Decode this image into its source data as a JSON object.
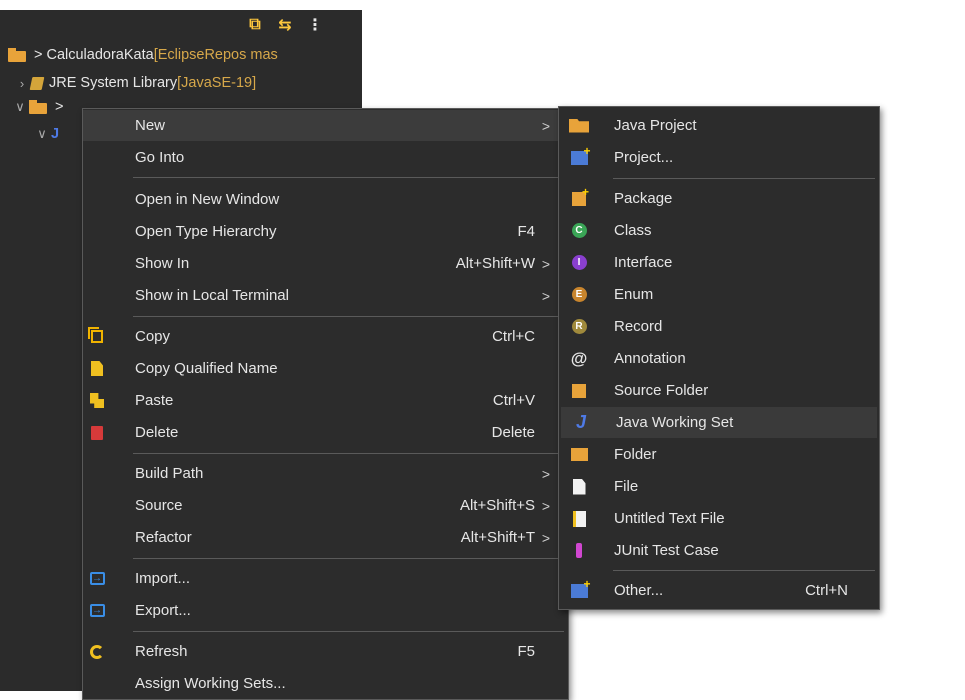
{
  "toolbar": {
    "icons": [
      "collapse-all-icon",
      "link-with-editor-icon",
      "view-menu-icon"
    ],
    "icon_color": "#ffc83d"
  },
  "tree": {
    "rows": [
      {
        "label": "CalculadoraKata",
        "decoration": " [EclipseRepos mas",
        "prefix": ">"
      },
      {
        "label": "JRE System Library",
        "decoration": " [JavaSE-19]"
      }
    ],
    "hidden_row_prefix": ">",
    "hidden_row2_glyph": "J"
  },
  "context_menu": {
    "items": [
      {
        "label": "New",
        "shortcut": "",
        "submenu": true,
        "icon": ""
      },
      {
        "label": "Go Into",
        "shortcut": "",
        "submenu": false,
        "icon": ""
      },
      {
        "label": "Open in New Window",
        "shortcut": "",
        "submenu": false,
        "icon": ""
      },
      {
        "label": "Open Type Hierarchy",
        "shortcut": "F4",
        "submenu": false,
        "icon": ""
      },
      {
        "label": "Show In",
        "shortcut": "Alt+Shift+W",
        "submenu": true,
        "icon": ""
      },
      {
        "label": "Show in Local Terminal",
        "shortcut": "",
        "submenu": true,
        "icon": ""
      },
      {
        "label": "Copy",
        "shortcut": "Ctrl+C",
        "submenu": false,
        "icon": "copy-icon"
      },
      {
        "label": "Copy Qualified Name",
        "shortcut": "",
        "submenu": false,
        "icon": "copy-qualified-name-icon"
      },
      {
        "label": "Paste",
        "shortcut": "Ctrl+V",
        "submenu": false,
        "icon": "paste-icon"
      },
      {
        "label": "Delete",
        "shortcut": "Delete",
        "submenu": false,
        "icon": "delete-icon"
      },
      {
        "label": "Build Path",
        "shortcut": "",
        "submenu": true,
        "icon": ""
      },
      {
        "label": "Source",
        "shortcut": "Alt+Shift+S",
        "submenu": true,
        "icon": ""
      },
      {
        "label": "Refactor",
        "shortcut": "Alt+Shift+T",
        "submenu": true,
        "icon": ""
      },
      {
        "label": "Import...",
        "shortcut": "",
        "submenu": false,
        "icon": "import-icon"
      },
      {
        "label": "Export...",
        "shortcut": "",
        "submenu": false,
        "icon": "export-icon"
      },
      {
        "label": "Refresh",
        "shortcut": "F5",
        "submenu": false,
        "icon": "refresh-icon"
      },
      {
        "label": "Assign Working Sets...",
        "shortcut": "",
        "submenu": false,
        "icon": ""
      }
    ],
    "arrow_glyph": ">"
  },
  "new_submenu": {
    "items": [
      {
        "label": "Java Project",
        "shortcut": "",
        "icon": "java-project-icon"
      },
      {
        "label": "Project...",
        "shortcut": "",
        "icon": "project-icon"
      },
      {
        "label": "Package",
        "shortcut": "",
        "icon": "package-icon"
      },
      {
        "label": "Class",
        "shortcut": "",
        "icon": "class-icon"
      },
      {
        "label": "Interface",
        "shortcut": "",
        "icon": "interface-icon"
      },
      {
        "label": "Enum",
        "shortcut": "",
        "icon": "enum-icon"
      },
      {
        "label": "Record",
        "shortcut": "",
        "icon": "record-icon"
      },
      {
        "label": "Annotation",
        "shortcut": "",
        "icon": "annotation-icon"
      },
      {
        "label": "Source Folder",
        "shortcut": "",
        "icon": "source-folder-icon"
      },
      {
        "label": "Java Working Set",
        "shortcut": "",
        "icon": "java-working-set-icon"
      },
      {
        "label": "Folder",
        "shortcut": "",
        "icon": "folder-icon"
      },
      {
        "label": "File",
        "shortcut": "",
        "icon": "file-icon"
      },
      {
        "label": "Untitled Text File",
        "shortcut": "",
        "icon": "untitled-text-file-icon"
      },
      {
        "label": "JUnit Test Case",
        "shortcut": "",
        "icon": "junit-test-case-icon"
      },
      {
        "label": "Other...",
        "shortcut": "Ctrl+N",
        "icon": "other-wizard-icon"
      }
    ],
    "icon_letters": {
      "class": "C",
      "interface": "I",
      "enum": "E",
      "record": "R",
      "annotation": "@",
      "working_set": "J"
    }
  },
  "colors": {
    "menu_bg": "#2c2c2c",
    "menu_border": "#5a5a5a",
    "hover_bg": "#3c3c3c",
    "text": "#e6e6e6",
    "decoration": "#d7a84a",
    "explorer_bg": "#2b2b2b"
  }
}
